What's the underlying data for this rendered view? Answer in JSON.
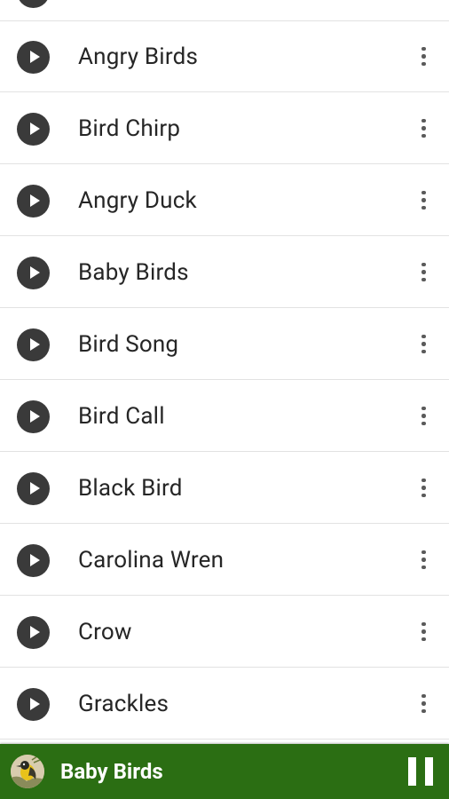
{
  "list": {
    "items": [
      {
        "label": ""
      },
      {
        "label": "Angry Birds"
      },
      {
        "label": "Bird Chirp"
      },
      {
        "label": "Angry Duck"
      },
      {
        "label": "Baby Birds"
      },
      {
        "label": "Bird Song"
      },
      {
        "label": "Bird Call"
      },
      {
        "label": "Black Bird"
      },
      {
        "label": "Carolina Wren"
      },
      {
        "label": "Crow"
      },
      {
        "label": "Grackles"
      }
    ]
  },
  "now_playing": {
    "title": "Baby Birds",
    "background_color": "#2b6e13"
  },
  "icons": {
    "play": "play-circle-icon",
    "more": "more-vert-icon",
    "pause": "pause-icon",
    "artwork": "bird-artwork-thumbnail"
  }
}
